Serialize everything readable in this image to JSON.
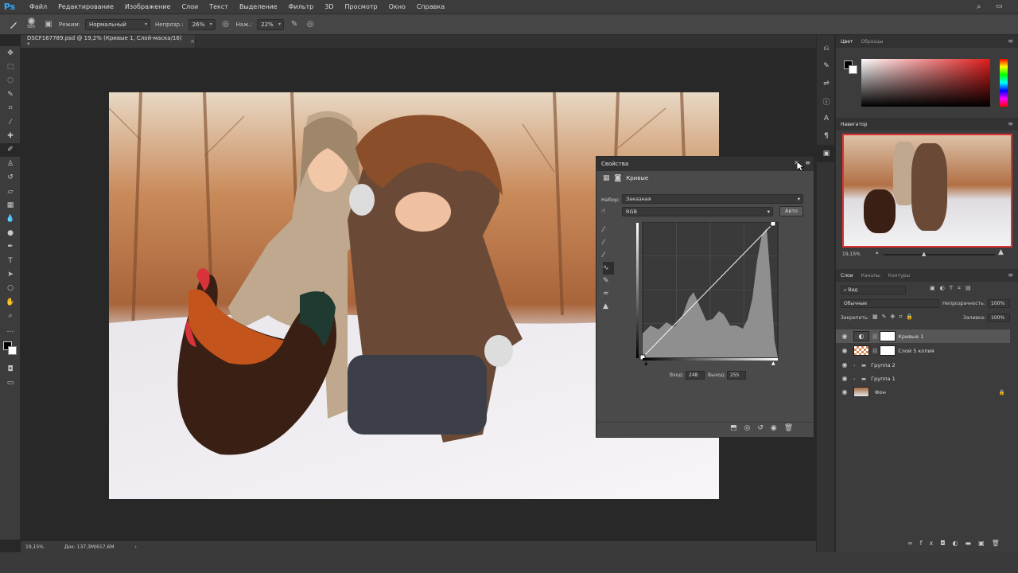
{
  "app": {
    "logo": "Ps"
  },
  "menu": [
    "Файл",
    "Редактирование",
    "Изображение",
    "Слои",
    "Текст",
    "Выделение",
    "Фильтр",
    "3D",
    "Просмотр",
    "Окно",
    "Справка"
  ],
  "options": {
    "brush_size": "500",
    "mode_label": "Режим:",
    "mode_value": "Нормальный",
    "opacity_label": "Непрозр.:",
    "opacity_value": "26%",
    "pressure_label": "Наж.:",
    "pressure_value": "22%"
  },
  "document": {
    "tab_title": "DSCF167789.psd @ 19,2% (Кривые 1, Слой-маска/16) *",
    "tab_close": "×",
    "zoom": "19,15%",
    "doc_info": "Док: 137,3M/617,6M",
    "status_arrow": "›"
  },
  "properties": {
    "title": "Свойства",
    "adjustment": "Кривые",
    "preset_label": "Набор:",
    "preset_value": "Заказная",
    "channel_value": "RGB",
    "auto_button": "Авто",
    "input_label": "Вход:",
    "input_value": "248",
    "output_label": "Выход:",
    "output_value": "255"
  },
  "color_panel": {
    "tabs": [
      "Цвет",
      "Образцы"
    ]
  },
  "navigator": {
    "title": "Навигатор",
    "zoom": "19,15%"
  },
  "layers_panel": {
    "tabs": [
      "Слои",
      "Каналы",
      "Контуры"
    ],
    "filter_value": "Вид",
    "blend_mode": "Обычные",
    "opacity_label": "Непрозрачность:",
    "opacity_value": "100%",
    "lock_label": "Закрепить:",
    "fill_label": "Заливка:",
    "fill_value": "100%",
    "layers": [
      {
        "name": "Кривые 1",
        "type": "adjustment",
        "selected": true
      },
      {
        "name": "Слой 5 копия",
        "type": "masked",
        "selected": false
      },
      {
        "name": "Группа 2",
        "type": "group",
        "selected": false
      },
      {
        "name": "Группа 1",
        "type": "group",
        "selected": false
      },
      {
        "name": "Фон",
        "type": "background",
        "selected": false
      }
    ]
  }
}
